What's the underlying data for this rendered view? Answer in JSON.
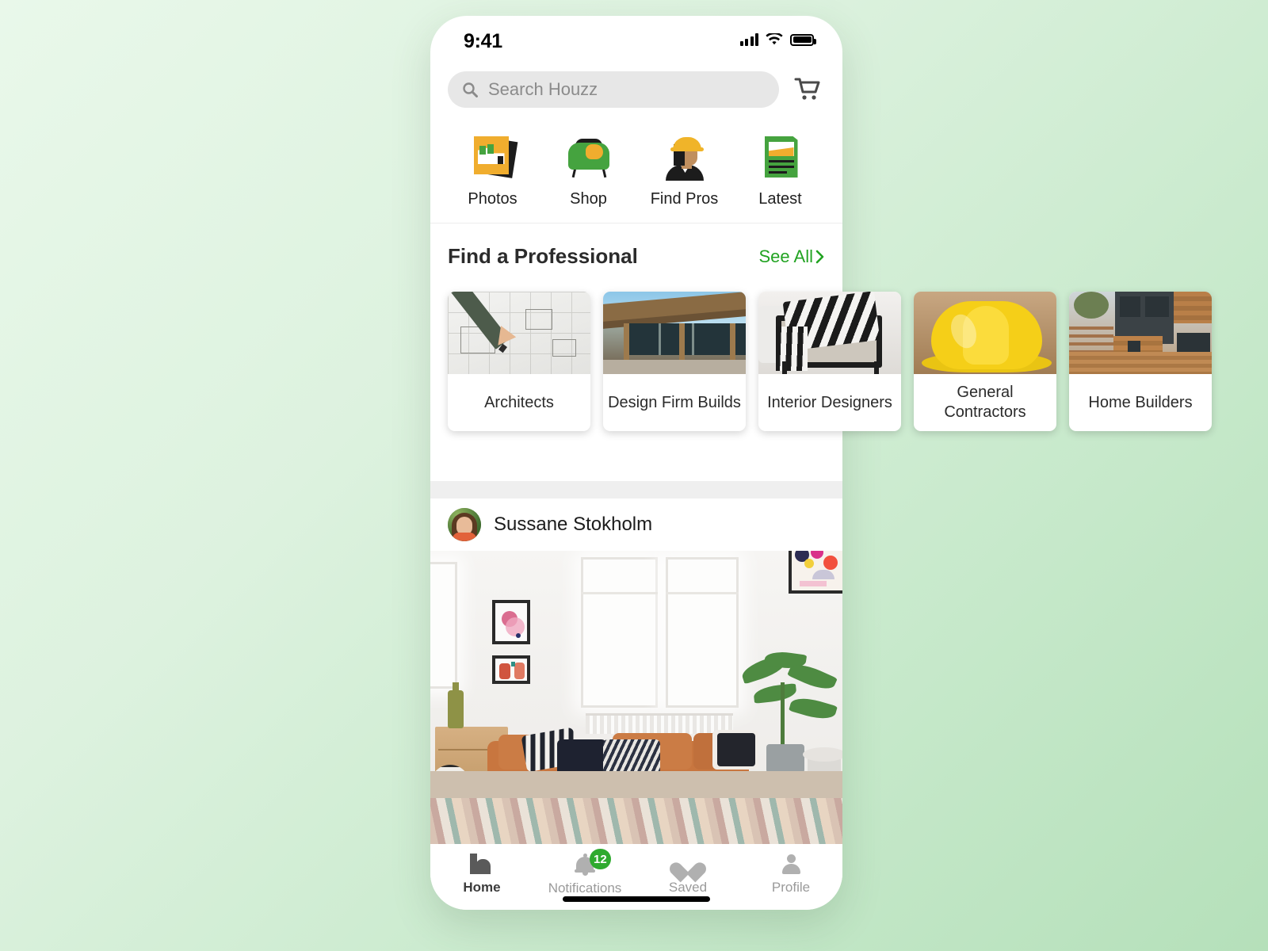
{
  "status_bar": {
    "time": "9:41",
    "signal_icon": "cellular-bars-icon",
    "wifi_icon": "wifi-icon",
    "battery_icon": "battery-full-icon"
  },
  "search": {
    "placeholder": "Search Houzz",
    "value": "",
    "icon": "search-icon",
    "cart_icon": "shopping-cart-icon"
  },
  "categories": [
    {
      "label": "Photos",
      "icon": "photos-icon"
    },
    {
      "label": "Shop",
      "icon": "shop-armchair-icon"
    },
    {
      "label": "Find Pros",
      "icon": "find-pros-hardhat-icon"
    },
    {
      "label": "Latest",
      "icon": "latest-article-icon"
    }
  ],
  "section": {
    "title": "Find a Professional",
    "see_all": "See All",
    "chevron": "chevron-right-icon"
  },
  "pro_cards": [
    {
      "label": "Architects",
      "image": "architect-blueprint-pencil"
    },
    {
      "label": "Design Firm Builds",
      "image": "modern-house-exterior"
    },
    {
      "label": "Interior Designers",
      "image": "striped-throw-armchair"
    },
    {
      "label": "General Contractors",
      "image": "yellow-hard-hat"
    },
    {
      "label": "Home Builders",
      "image": "wood-and-dark-modern-home"
    }
  ],
  "feed": {
    "user_name": "Sussane Stokholm",
    "avatar": "user-avatar",
    "photo": "living-room-tan-sectional-sofa"
  },
  "tabs": [
    {
      "label": "Home",
      "icon": "home-icon",
      "active": true,
      "badge": ""
    },
    {
      "label": "Notifications",
      "icon": "bell-icon",
      "active": false,
      "badge": "12"
    },
    {
      "label": "Saved",
      "icon": "heart-icon",
      "active": false,
      "badge": ""
    },
    {
      "label": "Profile",
      "icon": "person-icon",
      "active": false,
      "badge": ""
    }
  ],
  "colors": {
    "accent_green": "#22a322",
    "badge_green": "#2eaa2e",
    "brand_yellow": "#f0ad2e",
    "search_bg": "#e7e7e7",
    "background": "#c7e9cb"
  }
}
